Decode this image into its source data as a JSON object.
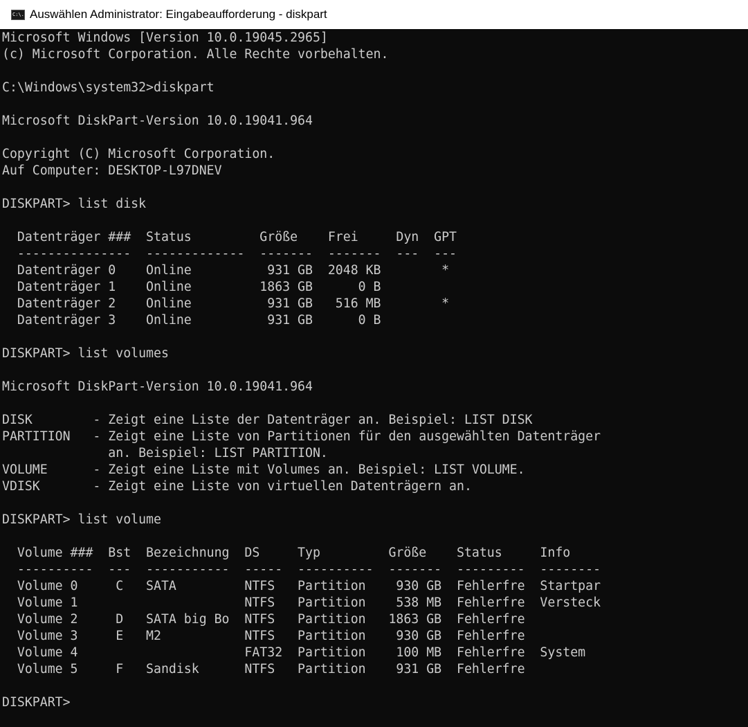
{
  "window": {
    "title": "Auswählen Administrator: Eingabeaufforderung - diskpart",
    "icon": "cmd-icon",
    "icon_label": "C:\\."
  },
  "colors": {
    "console_background": "#0c0c0c",
    "console_text": "#cccccc",
    "titlebar_background": "#ffffff"
  },
  "console": {
    "lines": [
      "Microsoft Windows [Version 10.0.19045.2965]",
      "(c) Microsoft Corporation. Alle Rechte vorbehalten.",
      "",
      "C:\\Windows\\system32>diskpart",
      "",
      "Microsoft DiskPart-Version 10.0.19041.964",
      "",
      "Copyright (C) Microsoft Corporation.",
      "Auf Computer: DESKTOP-L97DNEV",
      "",
      "DISKPART> list disk",
      "",
      "  Datenträger ###  Status         Größe    Frei     Dyn  GPT",
      "  ---------------  -------------  -------  -------  ---  ---",
      "  Datenträger 0    Online          931 GB  2048 KB        *",
      "  Datenträger 1    Online         1863 GB      0 B",
      "  Datenträger 2    Online          931 GB   516 MB        *",
      "  Datenträger 3    Online          931 GB      0 B",
      "",
      "DISKPART> list volumes",
      "",
      "Microsoft DiskPart-Version 10.0.19041.964",
      "",
      "DISK        - Zeigt eine Liste der Datenträger an. Beispiel: LIST DISK",
      "PARTITION   - Zeigt eine Liste von Partitionen für den ausgewählten Datenträger",
      "              an. Beispiel: LIST PARTITION.",
      "VOLUME      - Zeigt eine Liste mit Volumes an. Beispiel: LIST VOLUME.",
      "VDISK       - Zeigt eine Liste von virtuellen Datenträgern an.",
      "",
      "DISKPART> list volume",
      "",
      "  Volume ###  Bst  Bezeichnung  DS     Typ         Größe    Status     Info",
      "  ----------  ---  -----------  -----  ----------  -------  ---------  --------",
      "  Volume 0     C   SATA         NTFS   Partition    930 GB  Fehlerfre  Startpar",
      "  Volume 1                      NTFS   Partition    538 MB  Fehlerfre  Versteck",
      "  Volume 2     D   SATA big Bo  NTFS   Partition   1863 GB  Fehlerfre",
      "  Volume 3     E   M2           NTFS   Partition    930 GB  Fehlerfre",
      "  Volume 4                      FAT32  Partition    100 MB  Fehlerfre  System",
      "  Volume 5     F   Sandisk      NTFS   Partition    931 GB  Fehlerfre",
      "",
      "DISKPART>"
    ]
  }
}
